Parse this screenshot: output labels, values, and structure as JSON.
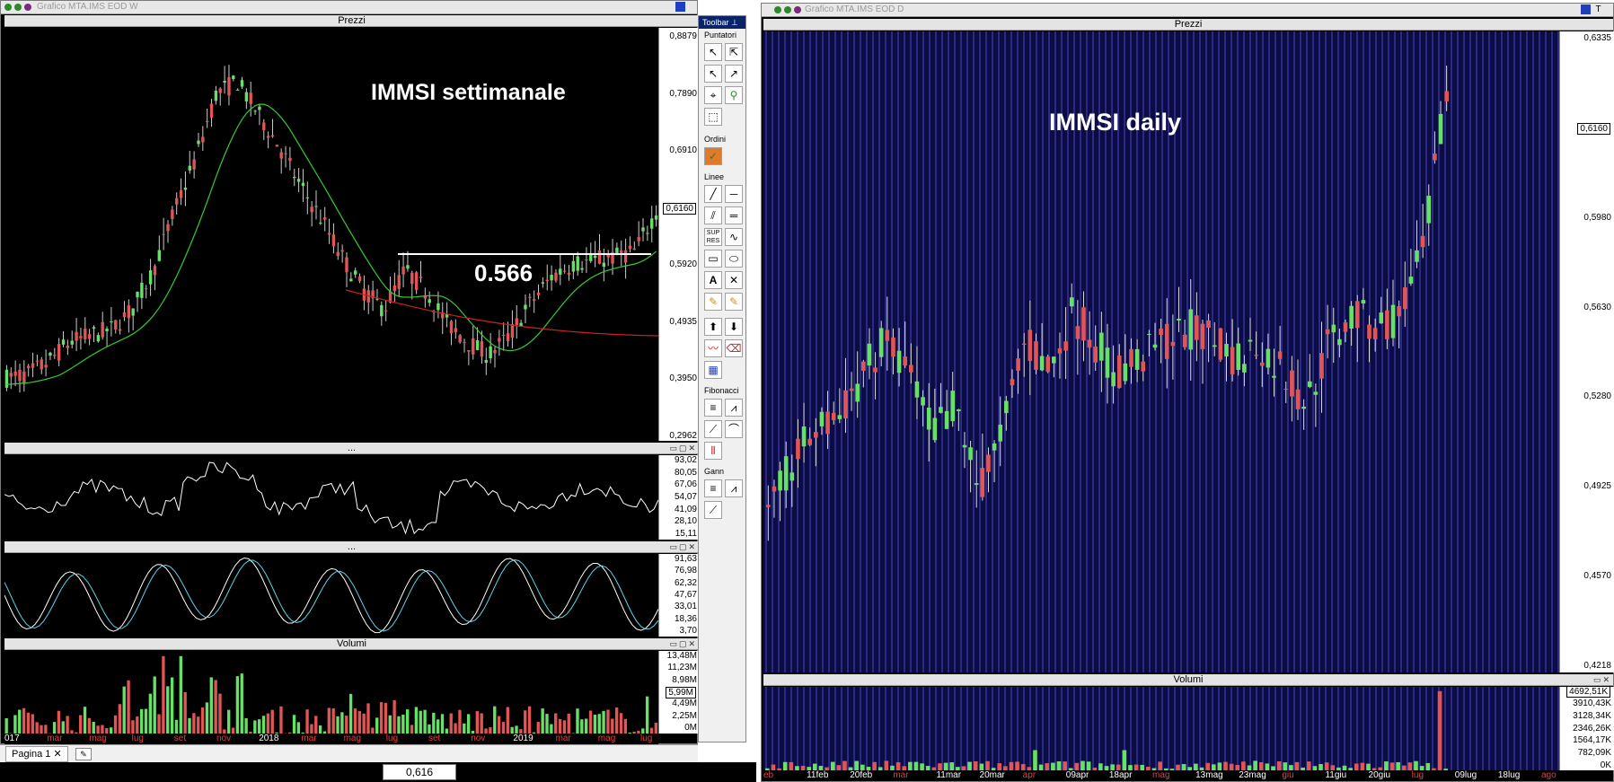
{
  "left_window": {
    "title": "Grafico MTA.IMS EOD W",
    "annotation": "IMMSI settimanale",
    "level_label": "0.566",
    "price_pane": {
      "title": "Prezzi",
      "ticks": [
        "0,8879",
        "0,7890",
        "0,6910",
        "0,6160",
        "0,5920",
        "0,4935",
        "0,3950",
        "0,2962"
      ],
      "last": "0,6160"
    },
    "rsi_pane": {
      "title": "...",
      "ticks": [
        "93,02",
        "80,05",
        "67,06",
        "54,07",
        "41,09",
        "28,10",
        "15,11"
      ]
    },
    "stoch_pane": {
      "title": "...",
      "ticks": [
        "91,63",
        "76,98",
        "62,32",
        "47,67",
        "33,01",
        "18,36",
        "3,70"
      ]
    },
    "volume_pane": {
      "title": "Volumi",
      "ticks": [
        "13,48M",
        "11,23M",
        "8,98M",
        "5,99M",
        "4,49M",
        "2,25M",
        "0M"
      ],
      "last": "5,99M"
    },
    "x_labels": [
      {
        "t": "017",
        "c": "white"
      },
      {
        "t": "mar",
        "c": "red"
      },
      {
        "t": "mag",
        "c": "red"
      },
      {
        "t": "lug",
        "c": "red"
      },
      {
        "t": "set",
        "c": "red"
      },
      {
        "t": "nov",
        "c": "red"
      },
      {
        "t": "2018",
        "c": "white"
      },
      {
        "t": "mar",
        "c": "red"
      },
      {
        "t": "mag",
        "c": "red"
      },
      {
        "t": "lug",
        "c": "red"
      },
      {
        "t": "set",
        "c": "red"
      },
      {
        "t": "nov",
        "c": "red"
      },
      {
        "t": "2019",
        "c": "white"
      },
      {
        "t": "mar",
        "c": "red"
      },
      {
        "t": "mag",
        "c": "red"
      },
      {
        "t": "lug",
        "c": "red"
      }
    ]
  },
  "toolbar": {
    "title": "Toolbar",
    "groups": [
      "Puntatori",
      "Ordini",
      "Linee",
      "Fibonacci",
      "Gann"
    ]
  },
  "right_window": {
    "title": "Grafico MTA.IMS EOD D",
    "annotation": "IMMSI daily",
    "price_pane": {
      "title": "Prezzi",
      "ticks": [
        "0,6335",
        "0,6160",
        "0,5980",
        "0,5630",
        "0,5280",
        "0,4925",
        "0,4570",
        "0,4218"
      ],
      "last": "0,6160"
    },
    "volume_pane": {
      "title": "Volumi",
      "ticks": [
        "4692,51K",
        "3910,43K",
        "3128,34K",
        "2346,26K",
        "1564,17K",
        "782,09K",
        "0K"
      ],
      "last": "4692,51K"
    },
    "x_labels": [
      {
        "t": "eb",
        "c": "red"
      },
      {
        "t": "11feb",
        "c": "white"
      },
      {
        "t": "20feb",
        "c": "white"
      },
      {
        "t": "mar",
        "c": "red"
      },
      {
        "t": "11mar",
        "c": "white"
      },
      {
        "t": "20mar",
        "c": "white"
      },
      {
        "t": "apr",
        "c": "red"
      },
      {
        "t": "09apr",
        "c": "white"
      },
      {
        "t": "18apr",
        "c": "white"
      },
      {
        "t": "mag",
        "c": "red"
      },
      {
        "t": "13mag",
        "c": "white"
      },
      {
        "t": "23mag",
        "c": "white"
      },
      {
        "t": "giu",
        "c": "red"
      },
      {
        "t": "11giu",
        "c": "white"
      },
      {
        "t": "20giu",
        "c": "white"
      },
      {
        "t": "lug",
        "c": "red"
      },
      {
        "t": "09lug",
        "c": "white"
      },
      {
        "t": "18lug",
        "c": "white"
      },
      {
        "t": "ago",
        "c": "red"
      }
    ]
  },
  "tabs": {
    "page": "Pagina 1"
  },
  "status": {
    "price": "0,616"
  },
  "colors": {
    "bull": "#66e066",
    "bear": "#e05555",
    "ma_green": "#33cc33",
    "ma_red": "#cc2222",
    "daily_bg": "#0b0b45",
    "daily_grid": "#4848b8"
  }
}
